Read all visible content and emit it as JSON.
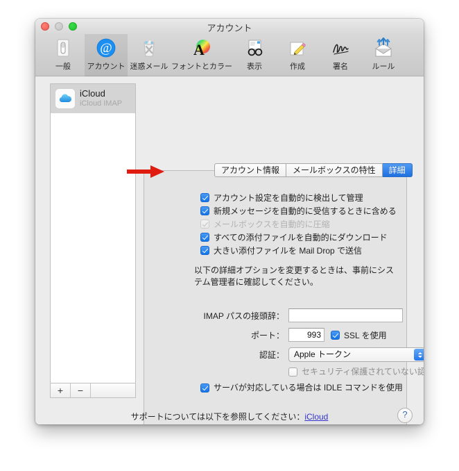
{
  "window": {
    "title": "アカウント",
    "traffic": {
      "close": "close-button",
      "minimize": "minimize-button",
      "zoom": "zoom-button"
    },
    "colors": {
      "close": "#ef5f56",
      "minimize": "#c4c4c4",
      "zoom": "#21c12f",
      "accent": "#1f6fe0",
      "checkbox_on": "#1174e8",
      "link": "#3333cc",
      "arrow": "#e01b10",
      "panel_bg": "#e4e4e4",
      "window_bg": "#ececec"
    }
  },
  "toolbar": {
    "items": [
      {
        "label": "一般",
        "icon": "general-icon",
        "selected": false
      },
      {
        "label": "アカウント",
        "icon": "at-sign-icon",
        "selected": true
      },
      {
        "label": "迷惑メール",
        "icon": "junk-icon",
        "selected": false
      },
      {
        "label": "フォントとカラー",
        "icon": "fonts-colors-icon",
        "selected": false
      },
      {
        "label": "表示",
        "icon": "viewing-icon",
        "selected": false
      },
      {
        "label": "作成",
        "icon": "composing-icon",
        "selected": false
      },
      {
        "label": "署名",
        "icon": "signature-icon",
        "selected": false
      },
      {
        "label": "ルール",
        "icon": "rules-icon",
        "selected": false
      }
    ]
  },
  "sidebar": {
    "account": {
      "name": "iCloud",
      "subtitle": "iCloud IMAP",
      "icon": "icloud-icon"
    },
    "add_label": "+",
    "remove_label": "−"
  },
  "tabs": [
    {
      "label": "アカウント情報",
      "active": false
    },
    {
      "label": "メールボックスの特性",
      "active": false
    },
    {
      "label": "詳細",
      "active": true
    }
  ],
  "checkboxes": [
    {
      "label": "アカウント設定を自動的に検出して管理",
      "checked": true,
      "enabled": true
    },
    {
      "label": "新規メッセージを自動的に受信するときに含める",
      "checked": true,
      "enabled": true
    },
    {
      "label": "メールボックスを自動的に圧縮",
      "checked": true,
      "enabled": false
    },
    {
      "label": "すべての添付ファイルを自動的にダウンロード",
      "checked": true,
      "enabled": true
    },
    {
      "label": "大きい添付ファイルを Mail Drop で送信",
      "checked": true,
      "enabled": true
    }
  ],
  "note": "以下の詳細オプションを変更するときは、事前にシステム管理者に確認してください。",
  "form": {
    "prefix_label": "IMAP パスの接頭辞：",
    "prefix_value": "",
    "prefix_placeholder": "",
    "port_label": "ポート：",
    "port_value": "993",
    "ssl_label": "SSL を使用",
    "ssl_checked": true,
    "auth_label": "認証：",
    "auth_value": "Apple トークン",
    "auth_options": [
      "Apple トークン"
    ],
    "insecure_label": "セキュリティ保護されていない認証を許可",
    "insecure_checked": false,
    "idle_label": "サーバが対応している場合は IDLE コマンドを使用",
    "idle_checked": true
  },
  "footer": {
    "support_text": "サポートについては以下を参照してください：",
    "support_link": "iCloud",
    "help_label": "?"
  },
  "annotation": {
    "type": "red-arrow",
    "points_to": "大きい添付ファイルを Mail Drop で送信"
  }
}
